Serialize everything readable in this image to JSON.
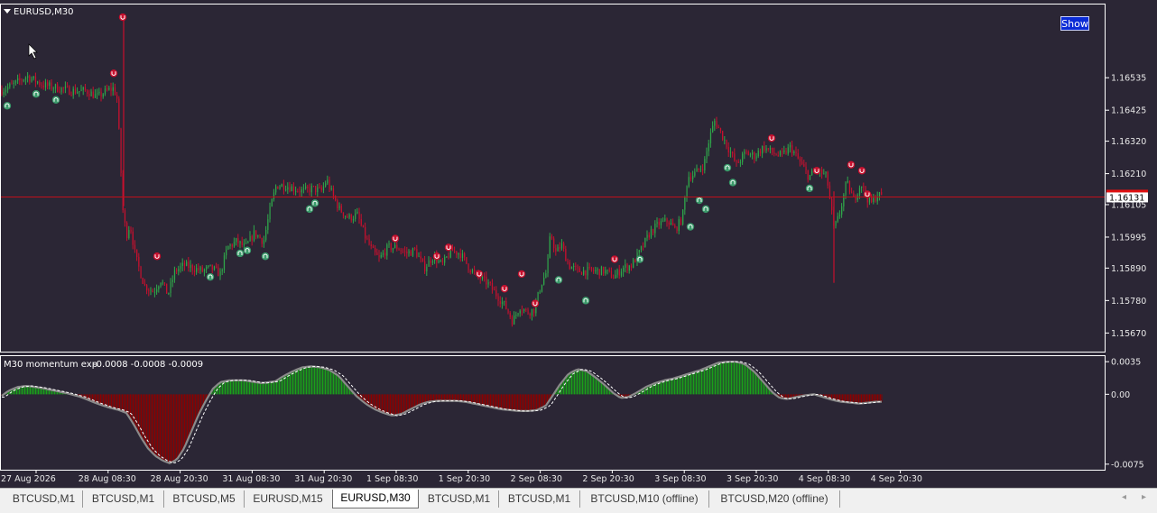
{
  "chart_data": [
    {
      "type": "candlestick",
      "title": "EURUSD,M30",
      "y_ticks": [
        "1.16535",
        "1.16425",
        "1.16320",
        "1.16210",
        "1.16105",
        "1.15995",
        "1.15890",
        "1.15780",
        "1.15670"
      ],
      "ylim": [
        1.1561,
        1.1678
      ],
      "current_price": 1.16131,
      "current_price_label": "1.16131",
      "x_labels": [
        "27 Aug 2026",
        "28 Aug 08:30",
        "28 Aug 20:30",
        "31 Aug 08:30",
        "31 Aug 20:30",
        "1 Sep 08:30",
        "1 Sep 20:30",
        "2 Sep 08:30",
        "2 Sep 20:30",
        "3 Sep 08:30",
        "3 Sep 20:30",
        "4 Sep 08:30",
        "4 Sep 20:30"
      ],
      "close_path": [
        [
          0,
          1.1649
        ],
        [
          14,
          1.1651
        ],
        [
          30,
          1.1654
        ],
        [
          48,
          1.1651
        ],
        [
          64,
          1.165
        ],
        [
          80,
          1.1649
        ],
        [
          96,
          1.1649
        ],
        [
          108,
          1.1647
        ],
        [
          118,
          1.1649
        ],
        [
          126,
          1.165
        ],
        [
          130,
          1.1646
        ],
        [
          136,
          1.1609
        ],
        [
          140,
          1.16
        ],
        [
          144,
          1.1604
        ],
        [
          150,
          1.1593
        ],
        [
          160,
          1.1583
        ],
        [
          170,
          1.1581
        ],
        [
          178,
          1.1585
        ],
        [
          186,
          1.158
        ],
        [
          194,
          1.1588
        ],
        [
          204,
          1.159
        ],
        [
          214,
          1.1589
        ],
        [
          224,
          1.1588
        ],
        [
          234,
          1.1589
        ],
        [
          244,
          1.1587
        ],
        [
          252,
          1.1596
        ],
        [
          262,
          1.1598
        ],
        [
          272,
          1.1596
        ],
        [
          282,
          1.1601
        ],
        [
          292,
          1.1598
        ],
        [
          300,
          1.161
        ],
        [
          306,
          1.1617
        ],
        [
          316,
          1.1617
        ],
        [
          326,
          1.1616
        ],
        [
          336,
          1.1615
        ],
        [
          346,
          1.1616
        ],
        [
          356,
          1.1615
        ],
        [
          362,
          1.1619
        ],
        [
          368,
          1.1614
        ],
        [
          376,
          1.1609
        ],
        [
          386,
          1.1606
        ],
        [
          396,
          1.1607
        ],
        [
          404,
          1.16
        ],
        [
          412,
          1.1595
        ],
        [
          420,
          1.1592
        ],
        [
          430,
          1.1596
        ],
        [
          440,
          1.1596
        ],
        [
          450,
          1.1594
        ],
        [
          460,
          1.1595
        ],
        [
          470,
          1.1589
        ],
        [
          480,
          1.1593
        ],
        [
          490,
          1.159
        ],
        [
          500,
          1.1595
        ],
        [
          510,
          1.1594
        ],
        [
          520,
          1.1589
        ],
        [
          530,
          1.1586
        ],
        [
          540,
          1.1584
        ],
        [
          550,
          1.158
        ],
        [
          560,
          1.1576
        ],
        [
          568,
          1.1571
        ],
        [
          576,
          1.1576
        ],
        [
          584,
          1.1574
        ],
        [
          592,
          1.1575
        ],
        [
          600,
          1.1584
        ],
        [
          606,
          1.1588
        ],
        [
          610,
          1.1601
        ],
        [
          616,
          1.1594
        ],
        [
          622,
          1.1597
        ],
        [
          630,
          1.159
        ],
        [
          640,
          1.1588
        ],
        [
          650,
          1.1588
        ],
        [
          660,
          1.1588
        ],
        [
          670,
          1.1588
        ],
        [
          680,
          1.1586
        ],
        [
          690,
          1.1589
        ],
        [
          700,
          1.159
        ],
        [
          710,
          1.1595
        ],
        [
          720,
          1.1601
        ],
        [
          730,
          1.1604
        ],
        [
          740,
          1.1605
        ],
        [
          748,
          1.1602
        ],
        [
          756,
          1.1606
        ],
        [
          762,
          1.162
        ],
        [
          770,
          1.1621
        ],
        [
          780,
          1.1624
        ],
        [
          786,
          1.1633
        ],
        [
          792,
          1.1639
        ],
        [
          800,
          1.1634
        ],
        [
          808,
          1.1629
        ],
        [
          816,
          1.1624
        ],
        [
          826,
          1.1628
        ],
        [
          836,
          1.1627
        ],
        [
          846,
          1.163
        ],
        [
          856,
          1.1628
        ],
        [
          866,
          1.1627
        ],
        [
          876,
          1.163
        ],
        [
          886,
          1.1625
        ],
        [
          896,
          1.162
        ],
        [
          906,
          1.1622
        ],
        [
          916,
          1.162
        ],
        [
          924,
          1.1602
        ],
        [
          930,
          1.1607
        ],
        [
          938,
          1.1618
        ],
        [
          946,
          1.1612
        ],
        [
          954,
          1.1618
        ],
        [
          960,
          1.1613
        ],
        [
          966,
          1.1611
        ],
        [
          972,
          1.1614
        ],
        [
          978,
          1.1613
        ]
      ],
      "arrows": [
        {
          "x": 8,
          "y": 1.1644,
          "dir": "up"
        },
        {
          "x": 40,
          "y": 1.1648,
          "dir": "up"
        },
        {
          "x": 62,
          "y": 1.1646,
          "dir": "up"
        },
        {
          "x": 136,
          "y": 1.1674,
          "dir": "down"
        },
        {
          "x": 126,
          "y": 1.1655,
          "dir": "down"
        },
        {
          "x": 174,
          "y": 1.1593,
          "dir": "down"
        },
        {
          "x": 233,
          "y": 1.1586,
          "dir": "up"
        },
        {
          "x": 266,
          "y": 1.1594,
          "dir": "up"
        },
        {
          "x": 274,
          "y": 1.1595,
          "dir": "up"
        },
        {
          "x": 294,
          "y": 1.1593,
          "dir": "up"
        },
        {
          "x": 343,
          "y": 1.1609,
          "dir": "up"
        },
        {
          "x": 349,
          "y": 1.1611,
          "dir": "up"
        },
        {
          "x": 438,
          "y": 1.1599,
          "dir": "down"
        },
        {
          "x": 484,
          "y": 1.1593,
          "dir": "down"
        },
        {
          "x": 497,
          "y": 1.1596,
          "dir": "down"
        },
        {
          "x": 531,
          "y": 1.1587,
          "dir": "down"
        },
        {
          "x": 559,
          "y": 1.1582,
          "dir": "down"
        },
        {
          "x": 578,
          "y": 1.1587,
          "dir": "down"
        },
        {
          "x": 593,
          "y": 1.1577,
          "dir": "down"
        },
        {
          "x": 619,
          "y": 1.1585,
          "dir": "up"
        },
        {
          "x": 649,
          "y": 1.1578,
          "dir": "up"
        },
        {
          "x": 681,
          "y": 1.1592,
          "dir": "down"
        },
        {
          "x": 709,
          "y": 1.1592,
          "dir": "up"
        },
        {
          "x": 765,
          "y": 1.1603,
          "dir": "up"
        },
        {
          "x": 775,
          "y": 1.1612,
          "dir": "up"
        },
        {
          "x": 782,
          "y": 1.1609,
          "dir": "up"
        },
        {
          "x": 806,
          "y": 1.1623,
          "dir": "up"
        },
        {
          "x": 812,
          "y": 1.1618,
          "dir": "up"
        },
        {
          "x": 855,
          "y": 1.1633,
          "dir": "down"
        },
        {
          "x": 897,
          "y": 1.1616,
          "dir": "up"
        },
        {
          "x": 905,
          "y": 1.1622,
          "dir": "down"
        },
        {
          "x": 943,
          "y": 1.1624,
          "dir": "down"
        },
        {
          "x": 955,
          "y": 1.1622,
          "dir": "down"
        },
        {
          "x": 961,
          "y": 1.1614,
          "dir": "down"
        }
      ]
    },
    {
      "type": "histogram",
      "title": "M30 momentum exp",
      "readout": "-0.0008 -0.0008 -0.0009",
      "y_ticks": [
        "0.0035",
        "0.00",
        "-0.0075"
      ],
      "ylim": [
        -0.008,
        0.004
      ],
      "momentum_path": [
        [
          0,
          -0.0003
        ],
        [
          10,
          0.0004
        ],
        [
          20,
          0.0008
        ],
        [
          30,
          0.0009
        ],
        [
          45,
          0.0007
        ],
        [
          60,
          0.0004
        ],
        [
          75,
          0.0001
        ],
        [
          90,
          -0.0003
        ],
        [
          105,
          -0.0009
        ],
        [
          120,
          -0.0014
        ],
        [
          132,
          -0.0017
        ],
        [
          140,
          -0.002
        ],
        [
          148,
          -0.0032
        ],
        [
          156,
          -0.0046
        ],
        [
          164,
          -0.0058
        ],
        [
          172,
          -0.0066
        ],
        [
          180,
          -0.0071
        ],
        [
          188,
          -0.0074
        ],
        [
          196,
          -0.007
        ],
        [
          204,
          -0.0058
        ],
        [
          212,
          -0.004
        ],
        [
          220,
          -0.0022
        ],
        [
          228,
          -0.0007
        ],
        [
          236,
          0.0006
        ],
        [
          244,
          0.0013
        ],
        [
          254,
          0.0015
        ],
        [
          270,
          0.0015
        ],
        [
          290,
          0.0012
        ],
        [
          305,
          0.0014
        ],
        [
          315,
          0.002
        ],
        [
          325,
          0.0025
        ],
        [
          335,
          0.0029
        ],
        [
          345,
          0.003
        ],
        [
          355,
          0.0029
        ],
        [
          365,
          0.0026
        ],
        [
          375,
          0.002
        ],
        [
          385,
          0.0009
        ],
        [
          395,
          -0.0002
        ],
        [
          405,
          -0.001
        ],
        [
          415,
          -0.0016
        ],
        [
          425,
          -0.002
        ],
        [
          435,
          -0.0023
        ],
        [
          445,
          -0.0021
        ],
        [
          455,
          -0.0016
        ],
        [
          465,
          -0.0011
        ],
        [
          475,
          -0.0008
        ],
        [
          485,
          -0.0007
        ],
        [
          495,
          -0.0007
        ],
        [
          505,
          -0.0007
        ],
        [
          515,
          -0.0008
        ],
        [
          525,
          -0.001
        ],
        [
          535,
          -0.0012
        ],
        [
          545,
          -0.0014
        ],
        [
          555,
          -0.0016
        ],
        [
          565,
          -0.0017
        ],
        [
          575,
          -0.0018
        ],
        [
          585,
          -0.0018
        ],
        [
          595,
          -0.0017
        ],
        [
          605,
          -0.0012
        ],
        [
          612,
          -0.0002
        ],
        [
          620,
          0.001
        ],
        [
          630,
          0.0022
        ],
        [
          640,
          0.0027
        ],
        [
          650,
          0.0025
        ],
        [
          660,
          0.0018
        ],
        [
          670,
          0.001
        ],
        [
          680,
          0.0001
        ],
        [
          688,
          -0.0004
        ],
        [
          696,
          -0.0003
        ],
        [
          706,
          0.0002
        ],
        [
          716,
          0.0008
        ],
        [
          726,
          0.0012
        ],
        [
          736,
          0.0015
        ],
        [
          746,
          0.0017
        ],
        [
          756,
          0.002
        ],
        [
          766,
          0.0023
        ],
        [
          776,
          0.0026
        ],
        [
          786,
          0.003
        ],
        [
          796,
          0.0034
        ],
        [
          806,
          0.0035
        ],
        [
          816,
          0.0035
        ],
        [
          826,
          0.0032
        ],
        [
          836,
          0.0024
        ],
        [
          846,
          0.0013
        ],
        [
          856,
          0.0002
        ],
        [
          864,
          -0.0004
        ],
        [
          872,
          -0.0005
        ],
        [
          882,
          -0.0003
        ],
        [
          892,
          -0.0001
        ],
        [
          902,
          0.0
        ],
        [
          912,
          -0.0003
        ],
        [
          922,
          -0.0006
        ],
        [
          932,
          -0.0008
        ],
        [
          942,
          -0.0009
        ],
        [
          952,
          -0.001
        ],
        [
          962,
          -0.0009
        ],
        [
          970,
          -0.0008
        ],
        [
          978,
          -0.0008
        ]
      ]
    }
  ],
  "tabs": [
    "BTCUSD,M1",
    "BTCUSD,M1",
    "BTCUSD,M5",
    "EURUSD,M15",
    "EURUSD,M30",
    "BTCUSD,M1",
    "BTCUSD,M1",
    "BTCUSD,M10 (offline)",
    "BTCUSD,M20 (offline)"
  ],
  "active_tab": "EURUSD,M30",
  "show_button_label": "Show",
  "colors": {
    "background": "#2b2635",
    "bull": "#2fa84a",
    "bear": "#c8102e",
    "histo_pos": "#1aa01a",
    "histo_neg": "#8b0000",
    "price_line": "#c0101a",
    "grid_text": "#e8e8e8",
    "up_arrow": "#3a9a6a",
    "down_arrow": "#c01a3a"
  }
}
